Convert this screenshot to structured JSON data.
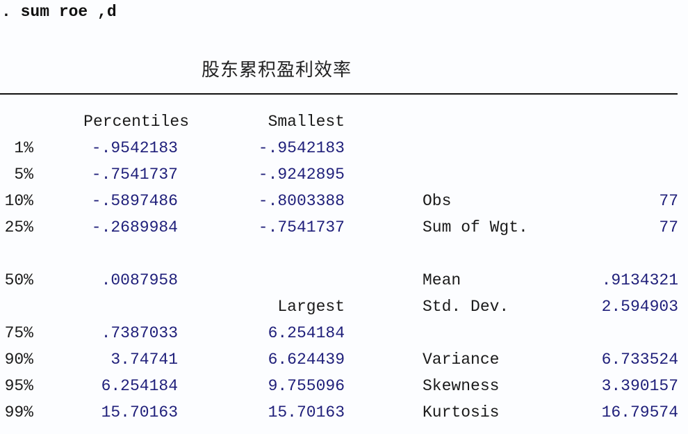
{
  "command": ". sum roe ,d",
  "variable_label": "股东累积盈利效率",
  "headers": {
    "percentiles": "Percentiles",
    "smallest": "Smallest",
    "largest": "Largest"
  },
  "rows": [
    {
      "pct": "1%",
      "percentile": "-.9542183",
      "extreme": "-.9542183",
      "stat_label": "",
      "stat_value": ""
    },
    {
      "pct": "5%",
      "percentile": "-.7541737",
      "extreme": "-.9242895",
      "stat_label": "",
      "stat_value": ""
    },
    {
      "pct": "10%",
      "percentile": "-.5897486",
      "extreme": "-.8003388",
      "stat_label": "Obs",
      "stat_value": "77"
    },
    {
      "pct": "25%",
      "percentile": "-.2689984",
      "extreme": "-.7541737",
      "stat_label": "Sum of Wgt.",
      "stat_value": "77"
    },
    {
      "pct": "50%",
      "percentile": ".0087958",
      "extreme": "",
      "stat_label": "Mean",
      "stat_value": ".9134321"
    },
    {
      "pct": "",
      "percentile": "",
      "extreme": "",
      "stat_label": "Std. Dev.",
      "stat_value": "2.594903"
    },
    {
      "pct": "75%",
      "percentile": ".7387033",
      "extreme": "6.254184",
      "stat_label": "",
      "stat_value": ""
    },
    {
      "pct": "90%",
      "percentile": "3.74741",
      "extreme": "6.624439",
      "stat_label": "Variance",
      "stat_value": "6.733524"
    },
    {
      "pct": "95%",
      "percentile": "6.254184",
      "extreme": "9.755096",
      "stat_label": "Skewness",
      "stat_value": "3.390157"
    },
    {
      "pct": "99%",
      "percentile": "15.70163",
      "extreme": "15.70163",
      "stat_label": "Kurtosis",
      "stat_value": "16.79574"
    }
  ],
  "colors": {
    "label_text": "#1a1a1a",
    "number_text": "#1f1f7a",
    "background": "#fcfdff"
  }
}
